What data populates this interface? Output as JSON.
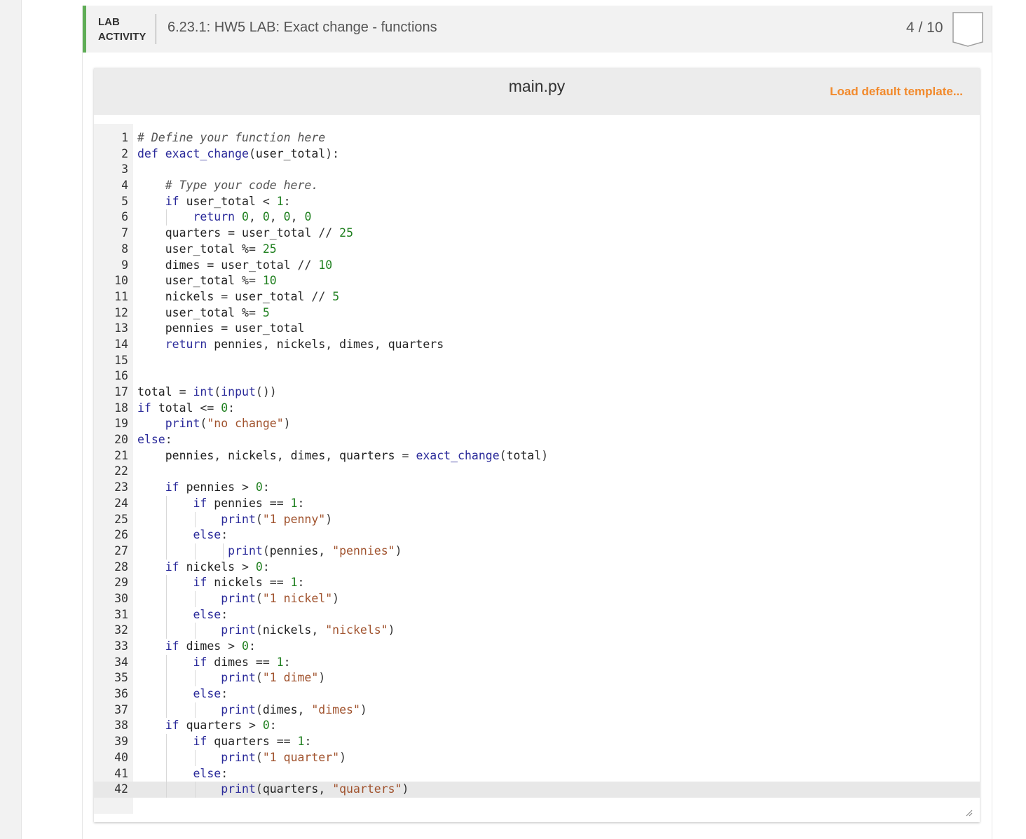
{
  "activity": {
    "label_line1": "LAB",
    "label_line2": "ACTIVITY",
    "title": "6.23.1: HW5 LAB: Exact change - functions",
    "score": "4 / 10",
    "accent_color": "#5fad56"
  },
  "editor": {
    "filename": "main.py",
    "load_default_label": "Load default template...",
    "load_default_color": "#f28a2c",
    "active_line": 42,
    "lines": [
      "# Define your function here",
      "def exact_change(user_total):",
      "",
      "    # Type your code here.",
      "    if user_total < 1:",
      "        return 0, 0, 0, 0",
      "    quarters = user_total // 25",
      "    user_total %= 25",
      "    dimes = user_total // 10",
      "    user_total %= 10",
      "    nickels = user_total // 5",
      "    user_total %= 5",
      "    pennies = user_total",
      "    return pennies, nickels, dimes, quarters",
      "",
      "",
      "total = int(input())",
      "if total <= 0:",
      "    print(\"no change\")",
      "else:",
      "    pennies, nickels, dimes, quarters = exact_change(total)",
      "",
      "    if pennies > 0:",
      "        if pennies == 1:",
      "            print(\"1 penny\")",
      "        else:",
      "             print(pennies, \"pennies\")",
      "    if nickels > 0:",
      "        if nickels == 1:",
      "            print(\"1 nickel\")",
      "        else:",
      "            print(nickels, \"nickels\")",
      "    if dimes > 0:",
      "        if dimes == 1:",
      "            print(\"1 dime\")",
      "        else:",
      "            print(dimes, \"dimes\")",
      "    if quarters > 0:",
      "        if quarters == 1:",
      "            print(\"1 quarter\")",
      "        else:",
      "            print(quarters, \"quarters\")"
    ]
  }
}
